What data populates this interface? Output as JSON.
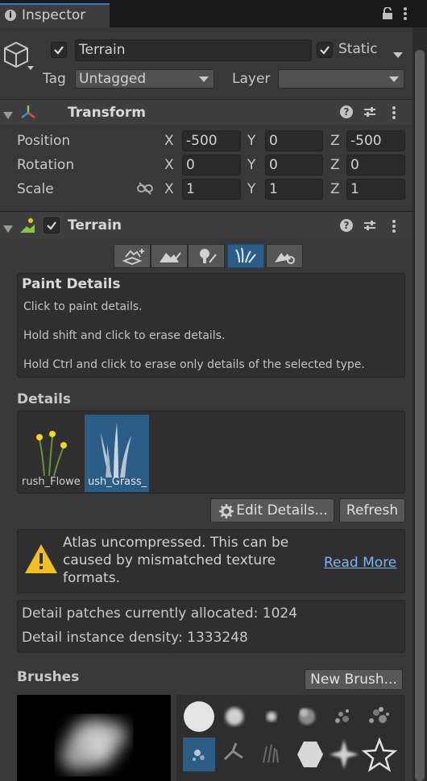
{
  "tab": {
    "title": "Inspector"
  },
  "header": {
    "object_name": "Terrain",
    "static_label": "Static",
    "tag_label": "Tag",
    "tag_value": "Untagged",
    "layer_label": "Layer",
    "layer_value": ""
  },
  "transform": {
    "title": "Transform",
    "rows": [
      {
        "label": "Position",
        "x": "-500",
        "y": "0",
        "z": "-500"
      },
      {
        "label": "Rotation",
        "x": "0",
        "y": "0",
        "z": "0"
      },
      {
        "label": "Scale",
        "x": "1",
        "y": "1",
        "z": "1"
      }
    ],
    "axes": [
      "X",
      "Y",
      "Z"
    ]
  },
  "terrain": {
    "title": "Terrain",
    "paint_details": {
      "title": "Paint Details",
      "lines": [
        "Click to paint details.",
        "Hold shift and click to erase details.",
        "Hold Ctrl and click to erase only details of the selected type."
      ]
    },
    "details_label": "Details",
    "detail_items": [
      {
        "label": "rush_Flowe"
      },
      {
        "label": "ush_Grass_"
      }
    ],
    "edit_details_label": "Edit Details...",
    "refresh_label": "Refresh",
    "warning": {
      "text_lines": [
        "Atlas uncompressed. This can be",
        "caused by mismatched texture",
        "formats."
      ],
      "link": "Read More"
    },
    "stats": [
      "Detail patches currently allocated: 1024",
      "Detail instance density: 1333248"
    ],
    "brushes_label": "Brushes",
    "new_brush_label": "New Brush..."
  },
  "colors": {
    "accent": "#3a79bb",
    "selected": "#2c5d87",
    "warning": "#f2c01e",
    "link": "#7cb4f2"
  }
}
